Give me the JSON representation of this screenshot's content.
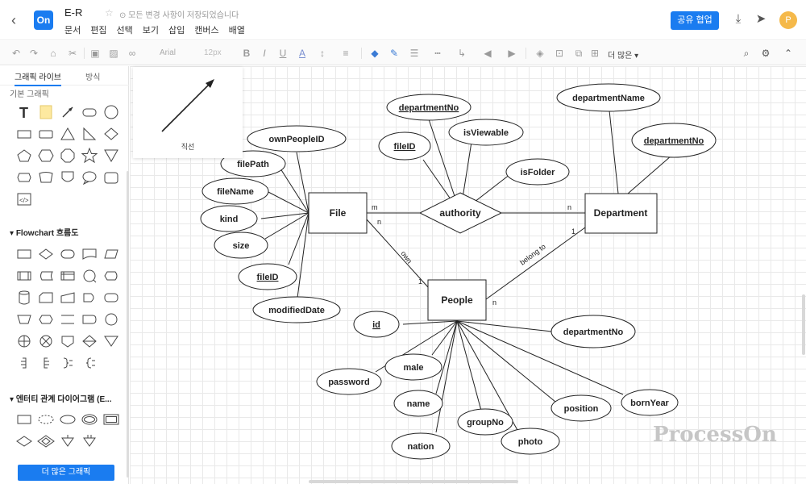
{
  "header": {
    "doc_title": "E-R",
    "save_status": "모든 변경 사항이 저장되었습니다",
    "menu": [
      "문서",
      "편집",
      "선택",
      "보기",
      "삽입",
      "캔버스",
      "배열"
    ],
    "share_label": "공유 협업",
    "avatar_letter": "P",
    "logo_text": "On"
  },
  "toolbar": {
    "font_name": "Arial",
    "font_size": "12px",
    "more_label": "더 많은"
  },
  "sidebar": {
    "tabs": [
      "그래픽 라이브",
      "방식"
    ],
    "sections": {
      "basic": "기본 그래픽",
      "flowchart": "Flowchart 흐름도",
      "er": "엔터티 관계 다이어그램 (E..."
    },
    "more_shapes_label": "더 많은 그래픽"
  },
  "preview": {
    "label": "직선"
  },
  "watermark": "ProcessOn",
  "diagram": {
    "entities": [
      "File",
      "Department",
      "People"
    ],
    "relationship": "authority",
    "file_attributes": [
      "ownPeopleID",
      "filePath",
      "fileName",
      "kind",
      "size",
      "fileID",
      "modifiedDate"
    ],
    "authority_attributes": [
      "departmentNo",
      "isViewable",
      "fileID",
      "isFolder"
    ],
    "department_attributes": [
      "departmentName",
      "departmentNo"
    ],
    "people_attributes": [
      "id",
      "departmentNo",
      "password",
      "male",
      "name",
      "groupNo",
      "nation",
      "photo",
      "position",
      "bornYear"
    ],
    "underlined": [
      "fileID",
      "departmentNo",
      "id"
    ],
    "edge_labels": {
      "file_authority": "m",
      "authority_department": "n",
      "own": "own",
      "own_file_end": "n",
      "own_people_end": "1",
      "belong_to": "belong to",
      "belong_dept_end": "1",
      "belong_people_end": "n"
    }
  }
}
